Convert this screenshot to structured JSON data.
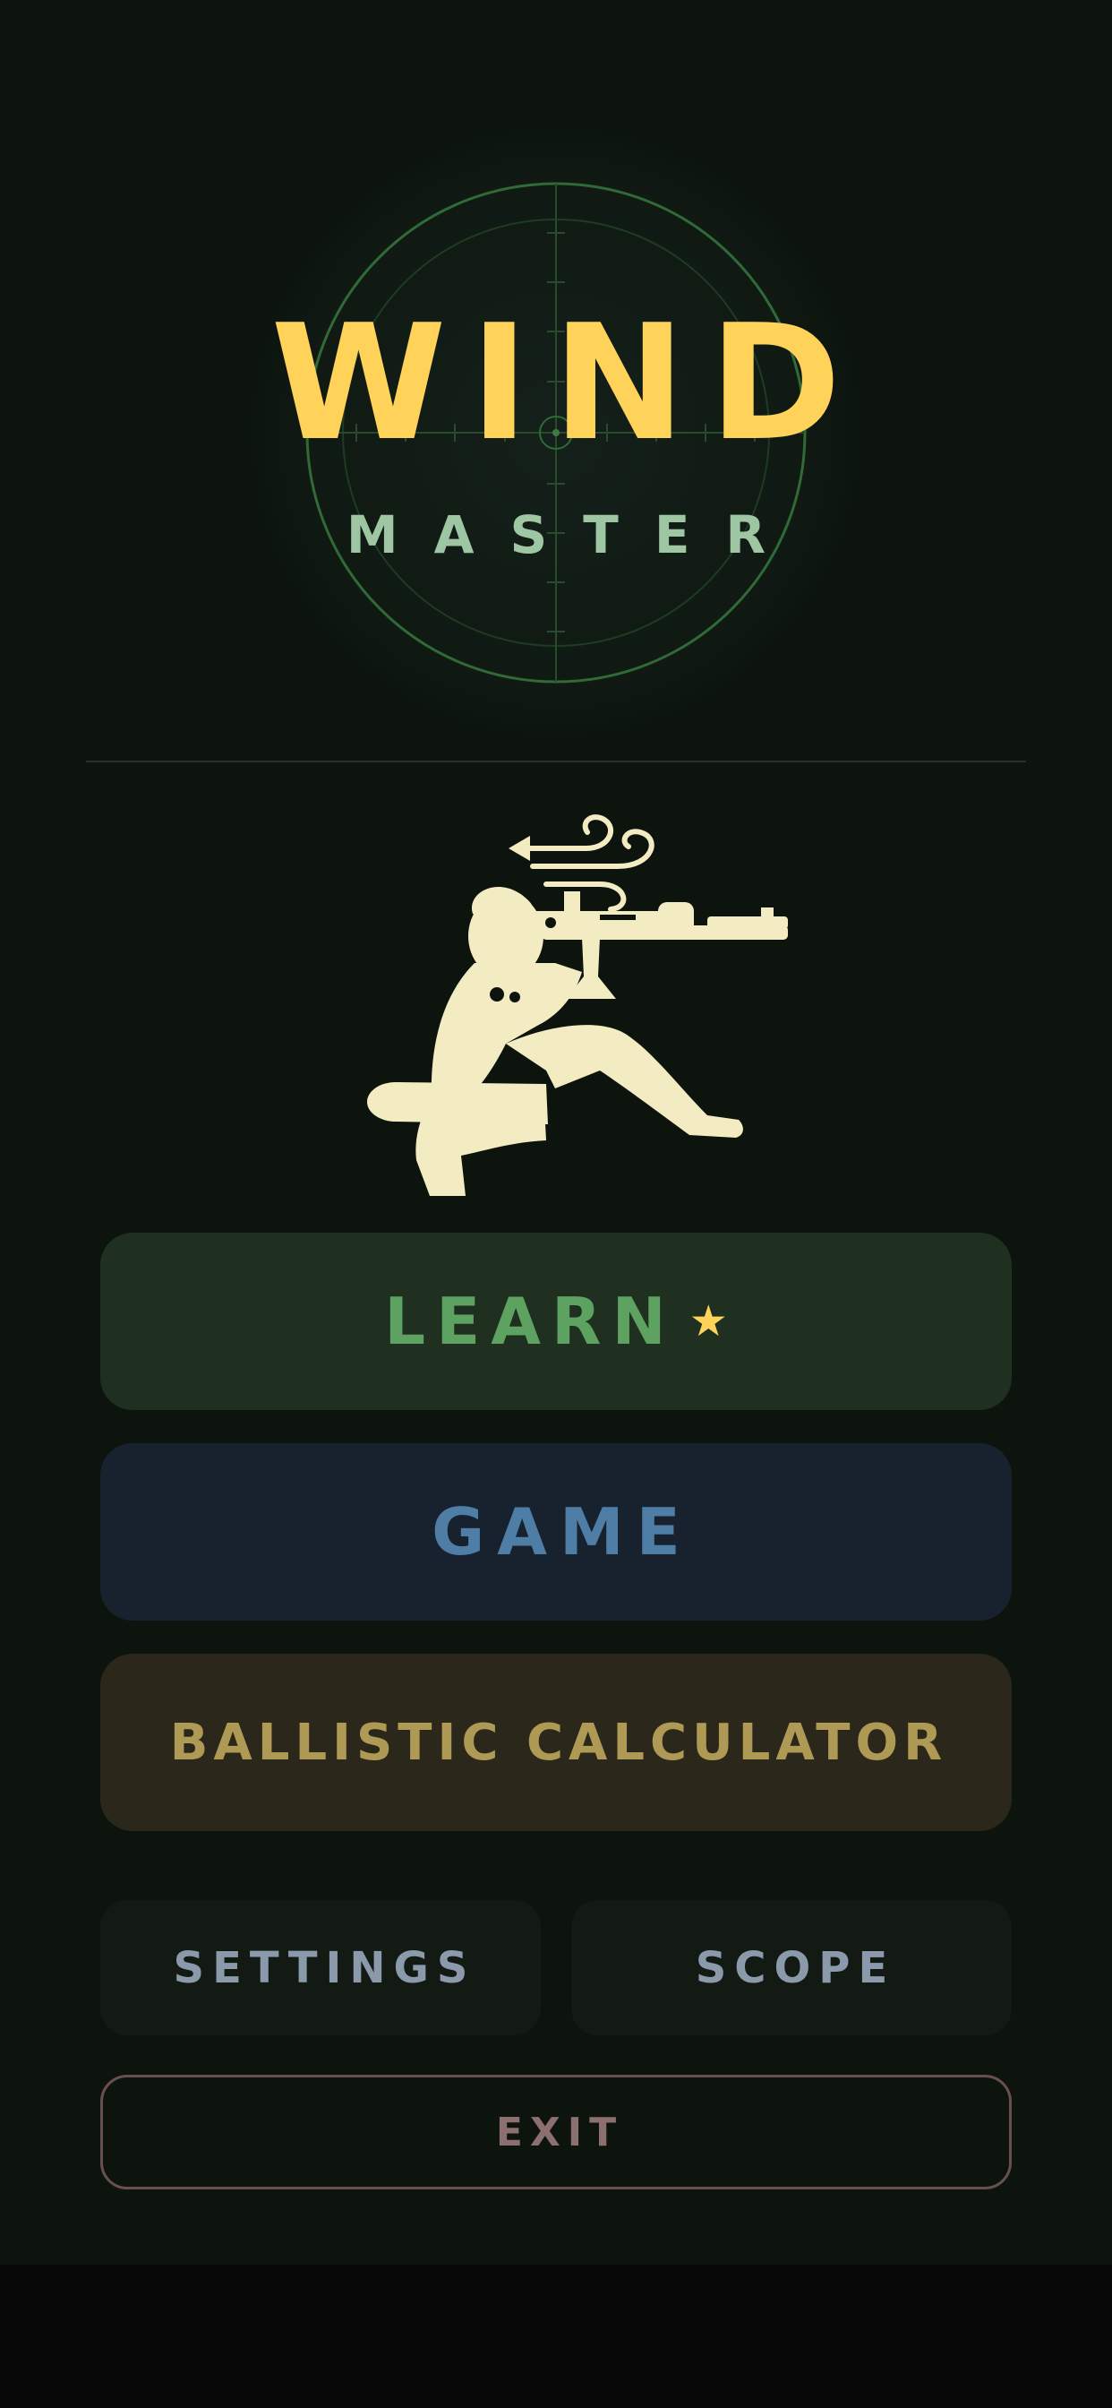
{
  "logo": {
    "title": "WIND",
    "subtitle": "MASTER"
  },
  "illustration": {
    "icon": "sniper-with-wind-icon"
  },
  "menu": {
    "learn_label": "LEARN",
    "learn_badge": "★",
    "game_label": "GAME",
    "calculator_label": "BALLISTIC CALCULATOR",
    "settings_label": "SETTINGS",
    "scope_label": "SCOPE",
    "exit_label": "EXIT"
  },
  "colors": {
    "background": "#0d140e",
    "title_yellow": "#ffd35a",
    "subtitle_green": "#9ec6a3",
    "learn_bg": "#1f3020",
    "learn_text": "#5ea261",
    "game_bg": "#18222f",
    "game_text": "#4e7ea6",
    "calc_bg": "#2c271b",
    "calc_text": "#ae9a55",
    "exit_border": "#6a4f4f",
    "illustration": "#f3ecc3"
  }
}
